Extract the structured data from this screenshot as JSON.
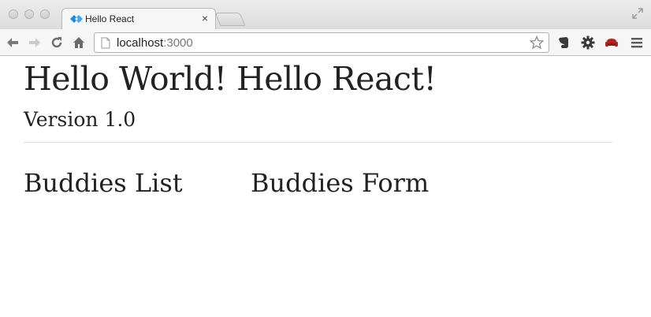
{
  "browser": {
    "tab": {
      "title": "Hello React",
      "close": "×"
    },
    "address": {
      "host": "localhost",
      "port": ":3000"
    }
  },
  "page": {
    "heading": "Hello World! Hello React!",
    "version": "Version 1.0",
    "buddies_list_title": "Buddies List",
    "buddies_form_title": "Buddies Form"
  },
  "colors": {
    "react_favicon": "#1e88e5",
    "sofa_extension": "#b21f1f"
  },
  "icons": [
    "react-favicon",
    "close-icon",
    "new-tab",
    "fullscreen-icon",
    "back-arrow-icon",
    "forward-arrow-icon",
    "reload-icon",
    "home-icon",
    "page-icon",
    "star-icon",
    "evernote-icon",
    "gear-icon",
    "sofa-icon",
    "menu-icon"
  ]
}
